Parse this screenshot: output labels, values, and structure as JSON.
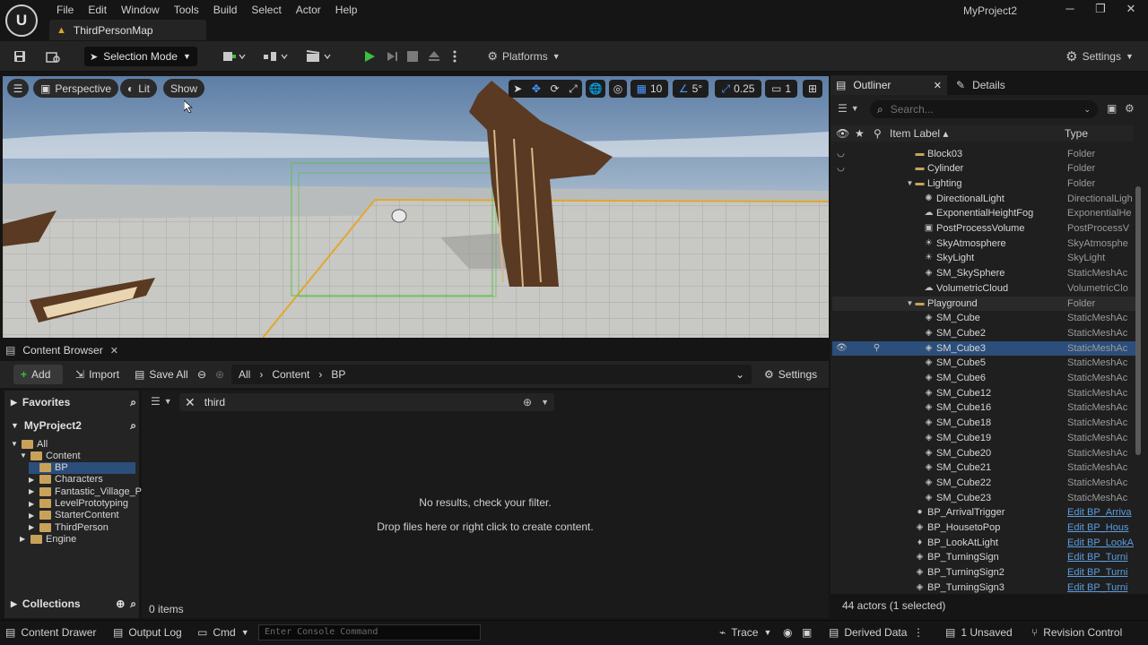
{
  "app": {
    "project": "MyProject2",
    "map_tab": "ThirdPersonMap",
    "logo": "U"
  },
  "menu": [
    "File",
    "Edit",
    "Window",
    "Tools",
    "Build",
    "Select",
    "Actor",
    "Help"
  ],
  "window_controls": {
    "minimize": "─",
    "restore": "❐",
    "close": "✕"
  },
  "toolbar": {
    "selection_mode": "Selection Mode",
    "platforms": "Platforms",
    "settings": "Settings"
  },
  "viewport": {
    "perspective": "Perspective",
    "lit": "Lit",
    "show": "Show",
    "grid_snap": "10",
    "rot_snap": "5°",
    "scale_snap": "0.25",
    "cam_speed": "1"
  },
  "content_browser": {
    "tab": "Content Browser",
    "add": "Add",
    "import": "Import",
    "save_all": "Save All",
    "breadcrumb": [
      "All",
      "Content",
      "BP"
    ],
    "settings": "Settings",
    "favorites": "Favorites",
    "project": "MyProject2",
    "filter_text": "third",
    "tree": [
      {
        "label": "All",
        "depth": 0
      },
      {
        "label": "Content",
        "depth": 1
      },
      {
        "label": "BP",
        "depth": 2,
        "selected": true
      },
      {
        "label": "Characters",
        "depth": 2
      },
      {
        "label": "Fantastic_Village_P",
        "depth": 2
      },
      {
        "label": "LevelPrototyping",
        "depth": 2
      },
      {
        "label": "StarterContent",
        "depth": 2
      },
      {
        "label": "ThirdPerson",
        "depth": 2
      },
      {
        "label": "Engine",
        "depth": 1
      }
    ],
    "collections": "Collections",
    "no_results": "No results, check your filter.",
    "drop_hint": "Drop files here or right click to create content.",
    "item_count": "0 items"
  },
  "outliner": {
    "tab": "Outliner",
    "details_tab": "Details",
    "search_placeholder": "Search...",
    "col_label": "Item Label ▴",
    "col_type": "Type",
    "rows": [
      {
        "label": "Block03",
        "type": "Folder",
        "kind": "folder",
        "indent": 0
      },
      {
        "label": "Cylinder",
        "type": "Folder",
        "kind": "folder",
        "indent": 0
      },
      {
        "label": "Lighting",
        "type": "Folder",
        "kind": "folder-open",
        "indent": 0
      },
      {
        "label": "DirectionalLight",
        "type": "DirectionalLigh",
        "kind": "light",
        "indent": 1
      },
      {
        "label": "ExponentialHeightFog",
        "type": "ExponentialHe",
        "kind": "fog",
        "indent": 1
      },
      {
        "label": "PostProcessVolume",
        "type": "PostProcessV",
        "kind": "volume",
        "indent": 1
      },
      {
        "label": "SkyAtmosphere",
        "type": "SkyAtmosphe",
        "kind": "sky",
        "indent": 1
      },
      {
        "label": "SkyLight",
        "type": "SkyLight",
        "kind": "sky",
        "indent": 1
      },
      {
        "label": "SM_SkySphere",
        "type": "StaticMeshAc",
        "kind": "mesh",
        "indent": 1
      },
      {
        "label": "VolumetricCloud",
        "type": "VolumetricClo",
        "kind": "cloud",
        "indent": 1
      },
      {
        "label": "Playground",
        "type": "Folder",
        "kind": "folder-open",
        "indent": 0
      },
      {
        "label": "SM_Cube",
        "type": "StaticMeshAc",
        "kind": "mesh",
        "indent": 1
      },
      {
        "label": "SM_Cube2",
        "type": "StaticMeshAc",
        "kind": "mesh",
        "indent": 1
      },
      {
        "label": "SM_Cube3",
        "type": "StaticMeshAc",
        "kind": "mesh",
        "indent": 1,
        "selected": true
      },
      {
        "label": "SM_Cube5",
        "type": "StaticMeshAc",
        "kind": "mesh",
        "indent": 1
      },
      {
        "label": "SM_Cube6",
        "type": "StaticMeshAc",
        "kind": "mesh",
        "indent": 1
      },
      {
        "label": "SM_Cube12",
        "type": "StaticMeshAc",
        "kind": "mesh",
        "indent": 1
      },
      {
        "label": "SM_Cube16",
        "type": "StaticMeshAc",
        "kind": "mesh",
        "indent": 1
      },
      {
        "label": "SM_Cube18",
        "type": "StaticMeshAc",
        "kind": "mesh",
        "indent": 1
      },
      {
        "label": "SM_Cube19",
        "type": "StaticMeshAc",
        "kind": "mesh",
        "indent": 1
      },
      {
        "label": "SM_Cube20",
        "type": "StaticMeshAc",
        "kind": "mesh",
        "indent": 1
      },
      {
        "label": "SM_Cube21",
        "type": "StaticMeshAc",
        "kind": "mesh",
        "indent": 1
      },
      {
        "label": "SM_Cube22",
        "type": "StaticMeshAc",
        "kind": "mesh",
        "indent": 1
      },
      {
        "label": "SM_Cube23",
        "type": "StaticMeshAc",
        "kind": "mesh",
        "indent": 1
      },
      {
        "label": "BP_ArrivalTrigger",
        "type": "Edit BP_Arriva",
        "kind": "bp",
        "indent": -1,
        "link": true
      },
      {
        "label": "BP_HousetoPop",
        "type": "Edit BP_Hous",
        "kind": "mesh",
        "indent": -1,
        "link": true
      },
      {
        "label": "BP_LookAtLight",
        "type": "Edit BP_LookA",
        "kind": "bulb",
        "indent": -1,
        "link": true
      },
      {
        "label": "BP_TurningSign",
        "type": "Edit BP_Turni",
        "kind": "mesh",
        "indent": -1,
        "link": true
      },
      {
        "label": "BP_TurningSign2",
        "type": "Edit BP_Turni",
        "kind": "mesh",
        "indent": -1,
        "link": true
      },
      {
        "label": "BP_TurningSign3",
        "type": "Edit BP_Turni",
        "kind": "mesh",
        "indent": -1,
        "link": true
      }
    ],
    "actor_count": "44 actors (1 selected)"
  },
  "statusbar": {
    "content_drawer": "Content Drawer",
    "output_log": "Output Log",
    "cmd": "Cmd",
    "console_placeholder": "Enter Console Command",
    "trace": "Trace",
    "derived_data": "Derived Data",
    "unsaved": "1 Unsaved",
    "revision_control": "Revision Control"
  },
  "colors": {
    "accent_blue": "#2f6fd6",
    "play_green": "#3cc13c",
    "selection": "#2c4e7a",
    "folder": "#c9a25a",
    "link": "#5b9de0"
  }
}
